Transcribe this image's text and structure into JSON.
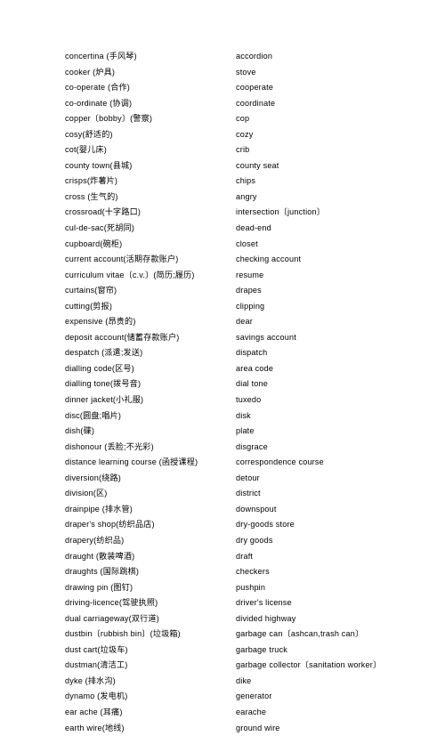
{
  "document": {
    "kind": "bilingual-glossary",
    "column_headers_visible": false,
    "text_color": "#000000",
    "background_color": "#ffffff"
  },
  "entries": [
    {
      "term": "concertina (手风琴)",
      "equivalent": "accordion"
    },
    {
      "term": "cooker (炉具)",
      "equivalent": "stove"
    },
    {
      "term": "co-operate (合作)",
      "equivalent": "cooperate"
    },
    {
      "term": "co-ordinate (协调)",
      "equivalent": "coordinate"
    },
    {
      "term": "copper〔bobby〕(警察)",
      "equivalent": "cop"
    },
    {
      "term": "cosy(舒适的)",
      "equivalent": "cozy"
    },
    {
      "term": "cot(婴儿床)",
      "equivalent": "crib"
    },
    {
      "term": "county town(县城)",
      "equivalent": "county seat"
    },
    {
      "term": "crisps(炸薯片)",
      "equivalent": "chips"
    },
    {
      "term": "cross (生气的)",
      "equivalent": "angry"
    },
    {
      "term": "crossroad(十字路口)",
      "equivalent": "intersection〔junction〕"
    },
    {
      "term": "cul-de-sac(死胡同)",
      "equivalent": "dead-end"
    },
    {
      "term": "cupboard(碗柜)",
      "equivalent": "closet"
    },
    {
      "term": "current account(活期存款账户)",
      "equivalent": "checking account"
    },
    {
      "term": "curriculum vitae〔c.v.〕(简历;履历)",
      "equivalent": "resume"
    },
    {
      "term": "curtains(窗帘)",
      "equivalent": "drapes"
    },
    {
      "term": "cutting(剪报)",
      "equivalent": "clipping"
    },
    {
      "term": "expensive (昂贵的)",
      "equivalent": "dear"
    },
    {
      "term": "deposit account(储蓄存款账户)",
      "equivalent": "savings account"
    },
    {
      "term": "despatch (派遣;发送)",
      "equivalent": "dispatch"
    },
    {
      "term": "dialling code(区号)",
      "equivalent": "area code"
    },
    {
      "term": "dialling tone(拨号音)",
      "equivalent": "dial tone"
    },
    {
      "term": "dinner jacket(小礼服)",
      "equivalent": "tuxedo"
    },
    {
      "term": "disc(圆盘;唱片)",
      "equivalent": "disk"
    },
    {
      "term": "dish(碟)",
      "equivalent": "plate"
    },
    {
      "term": "dishonour (丢脸;不光彩)",
      "equivalent": "disgrace"
    },
    {
      "term": "distance learning course (函授课程)",
      "equivalent": "correspondence course"
    },
    {
      "term": "diversion(绕路)",
      "equivalent": "detour"
    },
    {
      "term": "division(区)",
      "equivalent": "district"
    },
    {
      "term": "drainpipe (排水管)",
      "equivalent": "downspout"
    },
    {
      "term": "draper's shop(纺织品店)",
      "equivalent": "dry-goods store"
    },
    {
      "term": "drapery(纺织品)",
      "equivalent": "dry goods"
    },
    {
      "term": "draught (散装啤酒)",
      "equivalent": "draft"
    },
    {
      "term": "draughts (国际跳棋)",
      "equivalent": "checkers"
    },
    {
      "term": "drawing pin (图钉)",
      "equivalent": "pushpin"
    },
    {
      "term": "driving-licence(驾驶执照)",
      "equivalent": "driver's license"
    },
    {
      "term": "dual carriageway(双行道)",
      "equivalent": "divided highway"
    },
    {
      "term": "dustbin〔rubbish bin〕(垃圾箱)",
      "equivalent": "garbage can〔ashcan,trash can〕"
    },
    {
      "term": "dust cart(垃圾车)",
      "equivalent": "garbage truck"
    },
    {
      "term": "dustman(清洁工)",
      "equivalent": "garbage collector〔sanitation worker〕"
    },
    {
      "term": "dyke (排水沟)",
      "equivalent": "dike"
    },
    {
      "term": "dynamo (发电机)",
      "equivalent": "generator"
    },
    {
      "term": "ear ache (耳痛)",
      "equivalent": "earache"
    },
    {
      "term": "earth wire(地线)",
      "equivalent": "ground wire"
    }
  ]
}
